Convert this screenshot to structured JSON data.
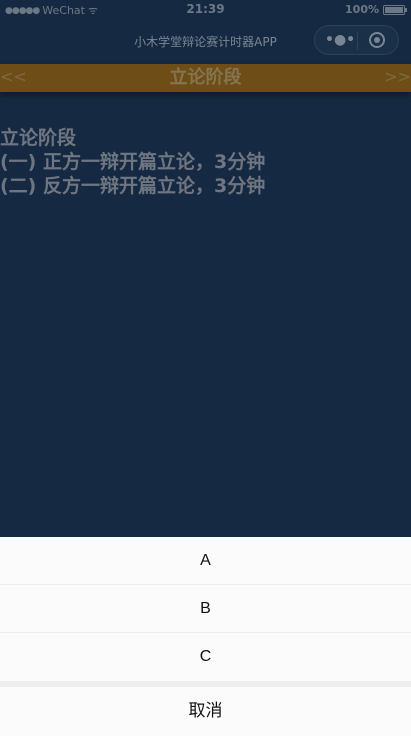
{
  "status_bar": {
    "carrier": "WeChat",
    "signal_dots": "●●●●●",
    "wifi_glyph": "ᯤ",
    "time": "21:39",
    "battery": "100%"
  },
  "nav": {
    "title": "小木学堂辩论赛计时器APP",
    "more_glyph": "•●•"
  },
  "stage": {
    "prev": "<<",
    "title": "立论阶段",
    "next": ">>"
  },
  "content": {
    "heading": "立论阶段",
    "lines": [
      "(一) 正方一辩开篇立论，3分钟",
      "(二) 反方一辩开篇立论，3分钟"
    ]
  },
  "action_sheet": {
    "options": [
      "A",
      "B",
      "C"
    ],
    "cancel": "取消"
  },
  "colors": {
    "background": "#152a42",
    "stage_bar": "#6e4e16",
    "sheet": "#fbfbfb"
  }
}
